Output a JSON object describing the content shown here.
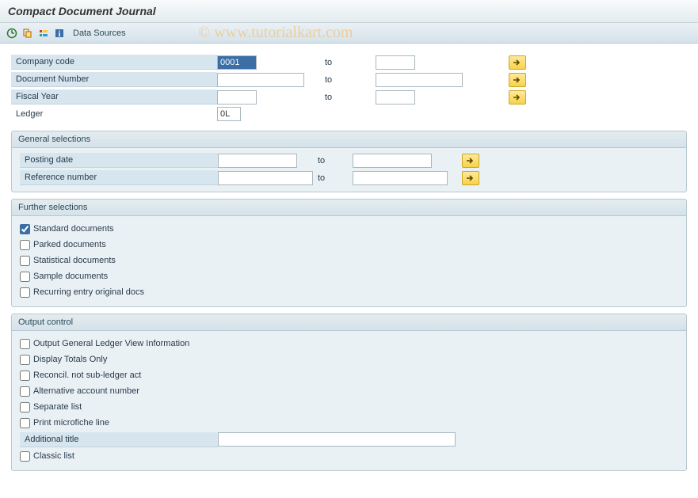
{
  "title": "Compact Document Journal",
  "toolbar": {
    "data_sources": "Data Sources"
  },
  "watermark": "©  www.tutorialkart.com",
  "top_fields": {
    "company_code": {
      "label": "Company code",
      "from": "0001",
      "to": "",
      "to_label": "to"
    },
    "document_number": {
      "label": "Document Number",
      "from": "",
      "to": "",
      "to_label": "to"
    },
    "fiscal_year": {
      "label": "Fiscal Year",
      "from": "",
      "to": "",
      "to_label": "to"
    },
    "ledger": {
      "label": "Ledger",
      "value": "0L"
    }
  },
  "general_selections": {
    "header": "General selections",
    "posting_date": {
      "label": "Posting date",
      "from": "",
      "to": "",
      "to_label": "to"
    },
    "reference_number": {
      "label": "Reference number",
      "from": "",
      "to": "",
      "to_label": "to"
    }
  },
  "further_selections": {
    "header": "Further selections",
    "items": [
      {
        "label": "Standard documents",
        "checked": true
      },
      {
        "label": "Parked documents",
        "checked": false
      },
      {
        "label": "Statistical documents",
        "checked": false
      },
      {
        "label": "Sample documents",
        "checked": false
      },
      {
        "label": "Recurring entry original docs",
        "checked": false
      }
    ]
  },
  "output_control": {
    "header": "Output control",
    "items": [
      {
        "label": "Output General Ledger View Information",
        "checked": false
      },
      {
        "label": "Display Totals Only",
        "checked": false
      },
      {
        "label": "Reconcil. not sub-ledger act",
        "checked": false
      },
      {
        "label": "Alternative account number",
        "checked": false
      },
      {
        "label": "Separate list",
        "checked": false
      },
      {
        "label": "Print microfiche line",
        "checked": false
      }
    ],
    "additional_title": {
      "label": "Additional title",
      "value": ""
    },
    "classic_list": {
      "label": "Classic list",
      "checked": false
    }
  }
}
